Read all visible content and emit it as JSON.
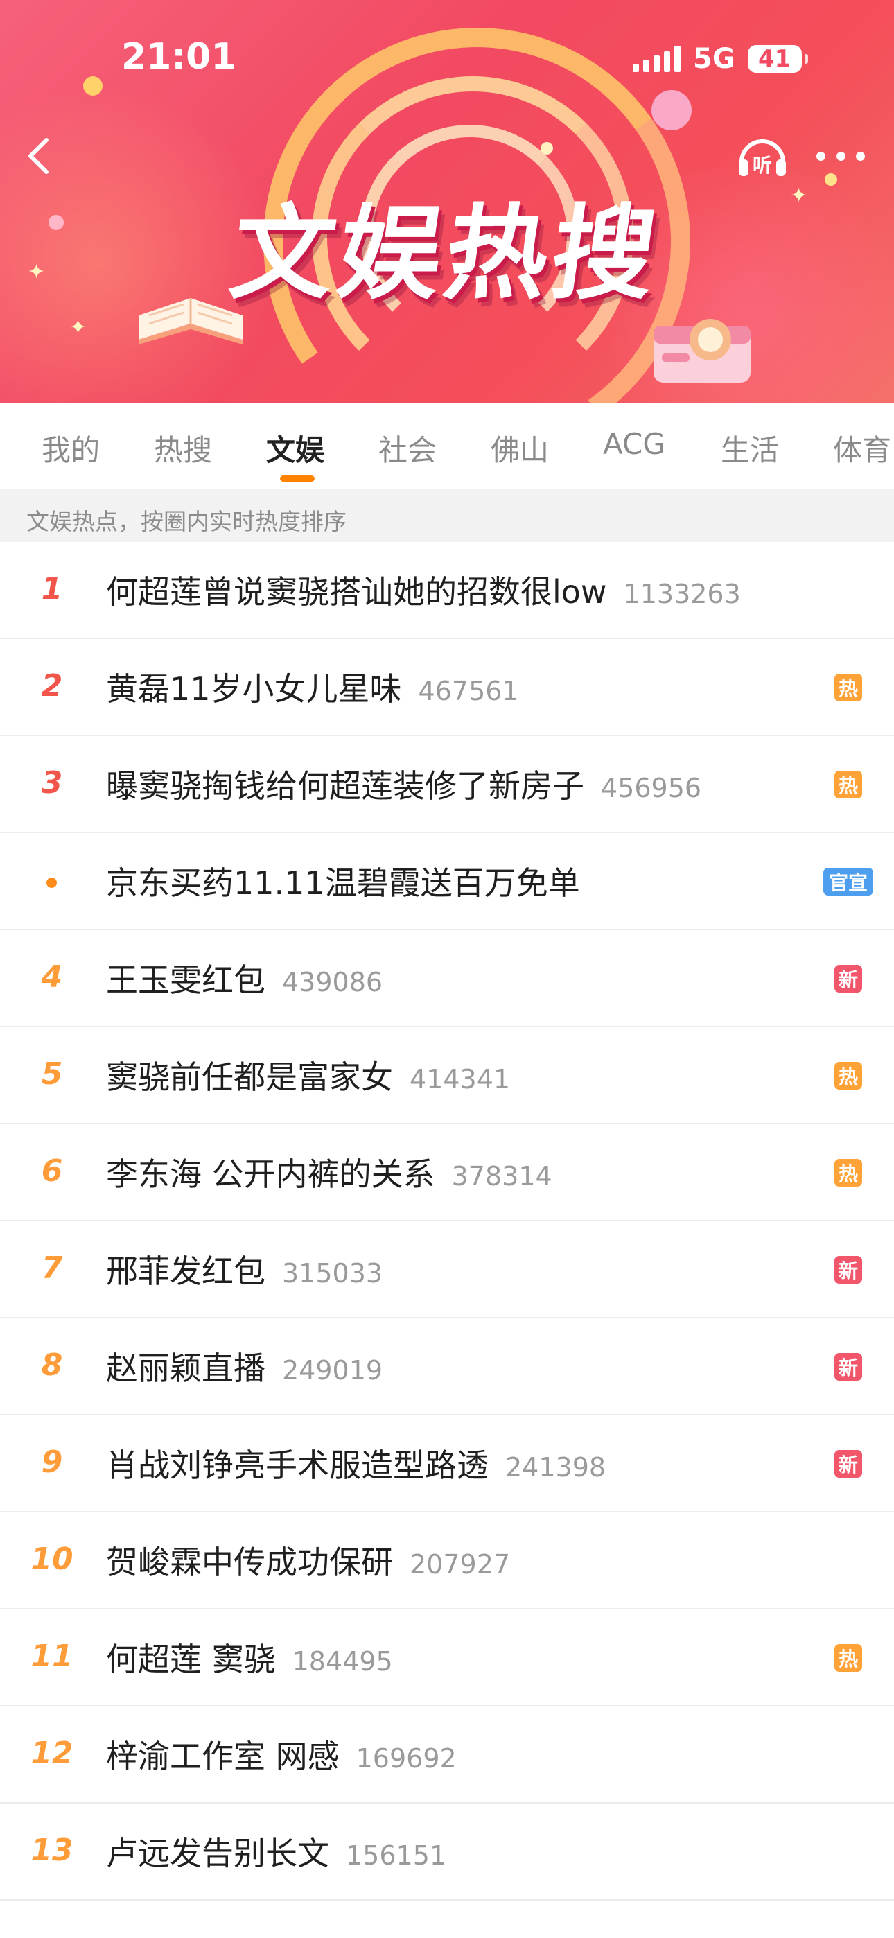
{
  "status_bar": {
    "time": "21:01",
    "network": "5G",
    "battery": "41"
  },
  "banner": {
    "title": "文娱热搜",
    "listen_icon_text": "听"
  },
  "tabs": [
    {
      "label": "我的"
    },
    {
      "label": "热搜"
    },
    {
      "label": "文娱",
      "active": true
    },
    {
      "label": "社会"
    },
    {
      "label": "佛山"
    },
    {
      "label": "ACG"
    },
    {
      "label": "生活"
    },
    {
      "label": "体育"
    }
  ],
  "notice": "文娱热点，按圈内实时热度排序",
  "list": [
    {
      "rank": "1",
      "title": "何超莲曾说窦骁搭讪她的招数很low",
      "heat": "1133263",
      "badge": ""
    },
    {
      "rank": "2",
      "title": "黄磊11岁小女儿星味",
      "heat": "467561",
      "badge": "热"
    },
    {
      "rank": "3",
      "title": "曝窦骁掏钱给何超莲装修了新房子",
      "heat": "456956",
      "badge": "热"
    },
    {
      "rank": "",
      "title": "京东买药11.11温碧霞送百万免单",
      "heat": "",
      "badge": "官宣"
    },
    {
      "rank": "4",
      "title": "王玉雯红包",
      "heat": "439086",
      "badge": "新"
    },
    {
      "rank": "5",
      "title": "窦骁前任都是富家女",
      "heat": "414341",
      "badge": "热"
    },
    {
      "rank": "6",
      "title": "李东海 公开内裤的关系",
      "heat": "378314",
      "badge": "热"
    },
    {
      "rank": "7",
      "title": "邢菲发红包",
      "heat": "315033",
      "badge": "新"
    },
    {
      "rank": "8",
      "title": "赵丽颖直播",
      "heat": "249019",
      "badge": "新"
    },
    {
      "rank": "9",
      "title": "肖战刘铮亮手术服造型路透",
      "heat": "241398",
      "badge": "新"
    },
    {
      "rank": "10",
      "title": "贺峻霖中传成功保研",
      "heat": "207927",
      "badge": ""
    },
    {
      "rank": "11",
      "title": "何超莲 窦骁",
      "heat": "184495",
      "badge": "热"
    },
    {
      "rank": "12",
      "title": "梓渝工作室 网感",
      "heat": "169692",
      "badge": ""
    },
    {
      "rank": "13",
      "title": "卢远发告别长文",
      "heat": "156151",
      "badge": ""
    }
  ],
  "colors": {
    "accent": "#ff8200",
    "rank_top": "#f2564b",
    "rank": "#ff9c3a",
    "hot": "#ffa238",
    "new": "#f2566a",
    "ad": "#4e9ef0"
  }
}
